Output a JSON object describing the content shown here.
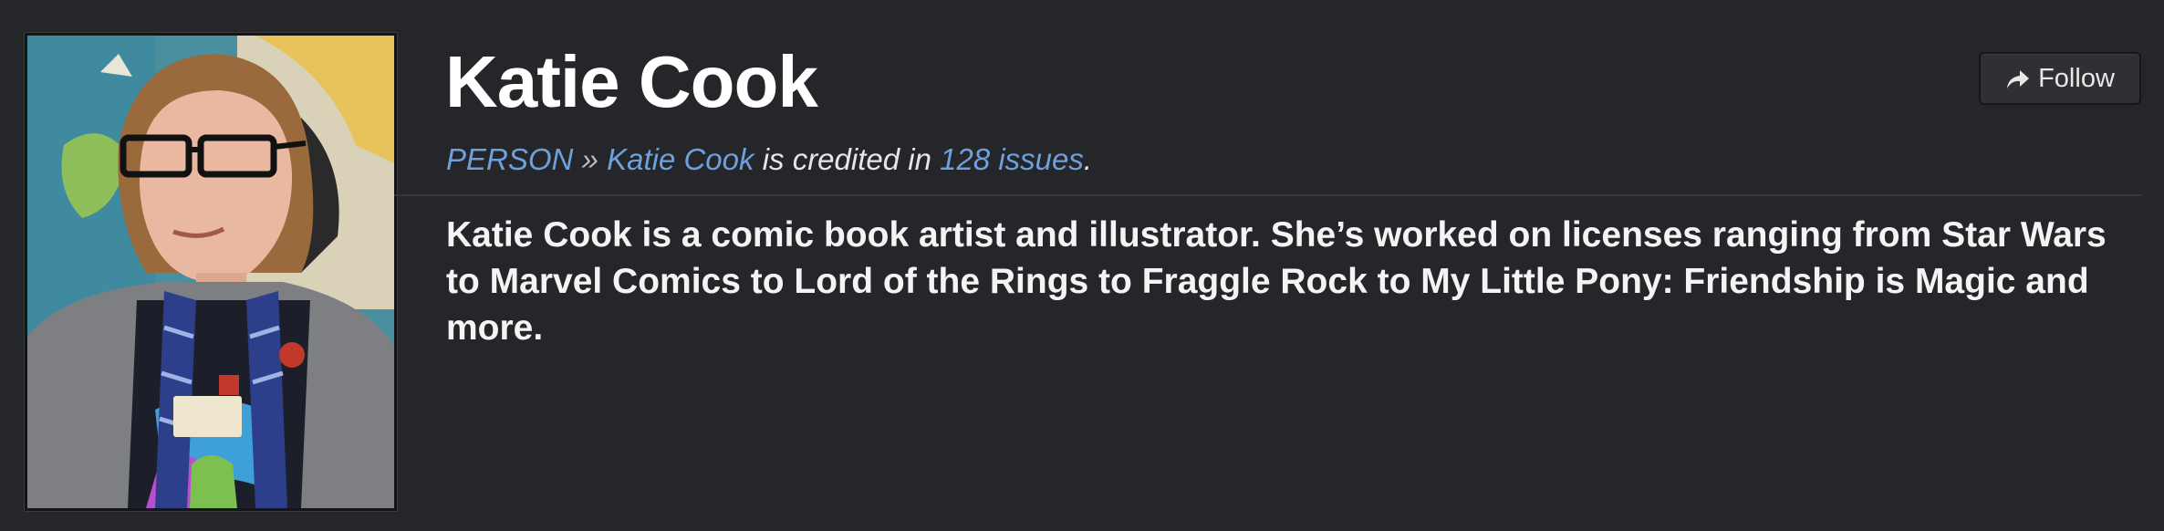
{
  "person": {
    "name": "Katie Cook",
    "photo_alt": "Katie Cook"
  },
  "follow_button": {
    "label": "Follow",
    "icon": "share-arrow-icon"
  },
  "breadcrumb": {
    "category": "PERSON",
    "separator": "»",
    "name": "Katie Cook",
    "text_middle": "is credited in",
    "issues_link": "128 issues",
    "text_end": "."
  },
  "bio": "Katie Cook is a comic book artist and illustrator. She’s worked on licenses ranging from Star Wars to Marvel Comics to Lord of the Rings to Fraggle Rock to My Little Pony: Friendship is Magic and more.",
  "colors": {
    "background": "#252629",
    "link": "#6ea0dc",
    "title": "#ffffff"
  }
}
